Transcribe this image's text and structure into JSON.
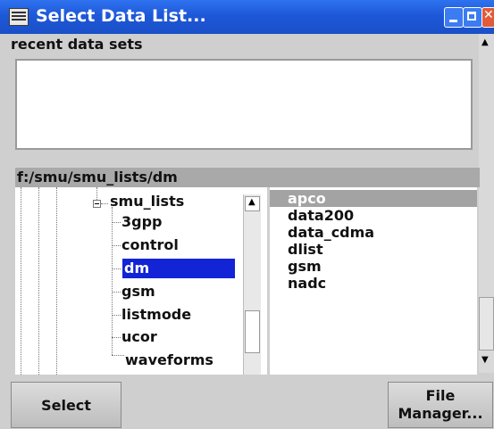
{
  "window": {
    "title": "Select Data List..."
  },
  "recent": {
    "label": "recent data sets"
  },
  "path": "f:/smu/smu_lists/dm",
  "tree": {
    "parent": "smu_lists",
    "children": [
      "3gpp",
      "control",
      "dm",
      "gsm",
      "listmode",
      "ucor",
      "waveforms"
    ],
    "selected": "dm"
  },
  "files": {
    "items": [
      "apco",
      "data200",
      "data_cdma",
      "dlist",
      "gsm",
      "nadc"
    ],
    "selected": "apco"
  },
  "buttons": {
    "select": "Select",
    "file_manager_line1": "File",
    "file_manager_line2": "Manager..."
  }
}
